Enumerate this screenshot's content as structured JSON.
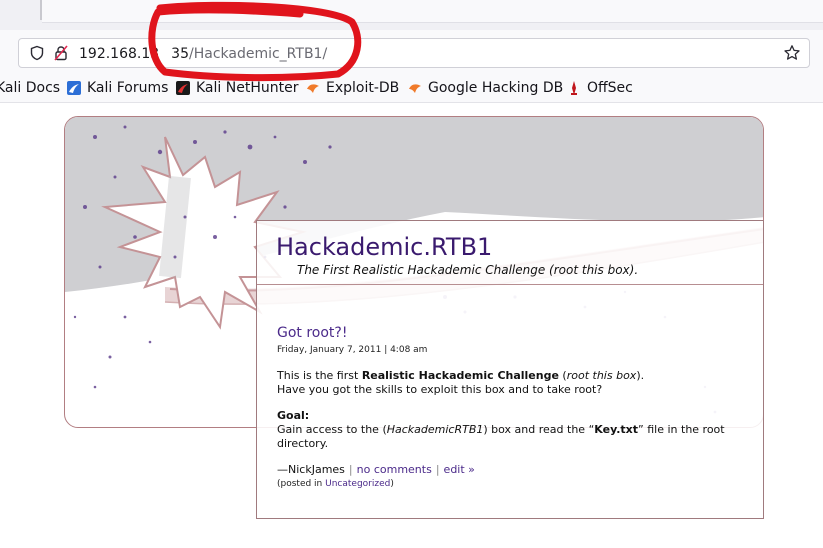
{
  "browser": {
    "url_host": "192.168.13",
    "url_port_fragment": "35",
    "url_path": "/Hackademic_RTB1/"
  },
  "bookmarks": [
    {
      "label": "Kali Docs",
      "icon": "kali-docs-icon"
    },
    {
      "label": "Kali Forums",
      "icon": "kali-forums-icon"
    },
    {
      "label": "Kali NetHunter",
      "icon": "kali-nethunter-icon"
    },
    {
      "label": "Exploit-DB",
      "icon": "exploit-db-icon"
    },
    {
      "label": "Google Hacking DB",
      "icon": "google-hacking-db-icon"
    },
    {
      "label": "OffSec",
      "icon": "offsec-icon"
    }
  ],
  "site": {
    "title": "Hackademic.RTB1",
    "tagline": "The First Realistic Hackademic Challenge (root this box)."
  },
  "post": {
    "title": "Got root?!",
    "date": "Friday, January 7, 2011 | 4:08 am",
    "line1_pre": "This is the first ",
    "line1_bold": "Realistic Hackademic Challenge",
    "line1_mid": " (",
    "line1_italic": "root this box",
    "line1_post": ").",
    "line2": "Have you got the skills to exploit this box and to take root?",
    "goal_label": "Goal:",
    "goal_pre": "Gain access to the (",
    "goal_italic": "HackademicRTB1",
    "goal_mid": ") box and read the  “",
    "goal_bold": "Key.txt",
    "goal_post": "”  file in the root",
    "goal_line2": "directory.",
    "author": "—NickJames",
    "comments_link": "no comments",
    "edit_link": "edit »",
    "posted_in_pre": "(posted in ",
    "category_link": "Uncategorized",
    "posted_in_post": ")"
  },
  "colors": {
    "annotation_red": "#e0141c",
    "title_purple": "#3a1a6e",
    "link_purple": "#4b2a8a"
  }
}
